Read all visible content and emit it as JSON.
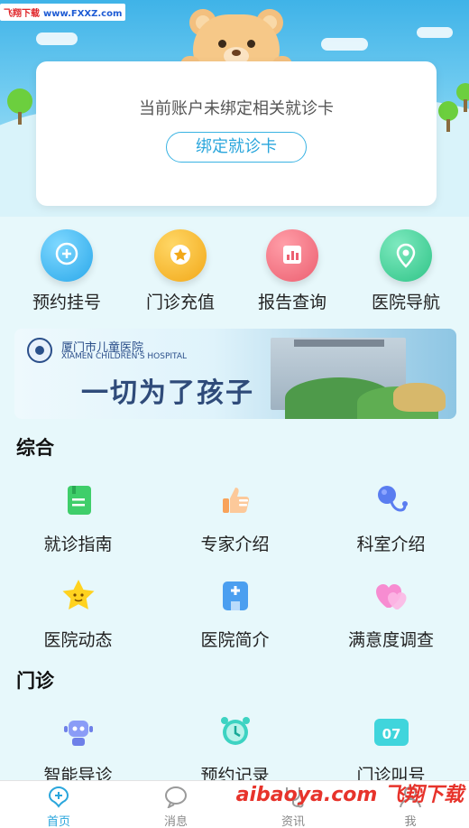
{
  "watermark_top": {
    "brand": "飞翔下载",
    "url": "www.FXXZ.com"
  },
  "card": {
    "message": "当前账户未绑定相关就诊卡",
    "bind_button": "绑定就诊卡"
  },
  "quick_actions": [
    {
      "label": "预约挂号",
      "icon": "plus-balloon-icon",
      "color": "#3cb6ee"
    },
    {
      "label": "门诊充值",
      "icon": "star-coin-icon",
      "color": "#f5b823"
    },
    {
      "label": "报告查询",
      "icon": "chart-report-icon",
      "color": "#f0707e"
    },
    {
      "label": "医院导航",
      "icon": "location-pin-icon",
      "color": "#3fd19b"
    }
  ],
  "banner": {
    "hospital_cn": "厦门市儿童医院",
    "hospital_en": "XIAMEN CHILDREN'S HOSPITAL",
    "slogan": "一切为了孩子"
  },
  "sections": [
    {
      "title": "综合",
      "items": [
        {
          "label": "就诊指南",
          "icon": "guide-book-icon"
        },
        {
          "label": "专家介绍",
          "icon": "thumbs-up-icon"
        },
        {
          "label": "科室介绍",
          "icon": "stethoscope-icon"
        },
        {
          "label": "医院动态",
          "icon": "star-face-icon"
        },
        {
          "label": "医院简介",
          "icon": "hospital-building-icon"
        },
        {
          "label": "满意度调查",
          "icon": "heart-icon"
        }
      ]
    },
    {
      "title": "门诊",
      "items": [
        {
          "label": "智能导诊",
          "icon": "robot-icon"
        },
        {
          "label": "预约记录",
          "icon": "alarm-clock-icon"
        },
        {
          "label": "门诊叫号",
          "icon": "calendar-number-icon",
          "badge": "07"
        }
      ]
    }
  ],
  "tabbar": [
    {
      "label": "首页",
      "icon": "home-medical-icon",
      "active": true
    },
    {
      "label": "消息",
      "icon": "chat-bubble-icon",
      "active": false
    },
    {
      "label": "资讯",
      "icon": "stethoscope-tab-icon",
      "active": false
    },
    {
      "label": "我",
      "icon": "user-icon",
      "active": false
    }
  ],
  "watermark_bottom": "aibaoya.com 飞翔下载"
}
